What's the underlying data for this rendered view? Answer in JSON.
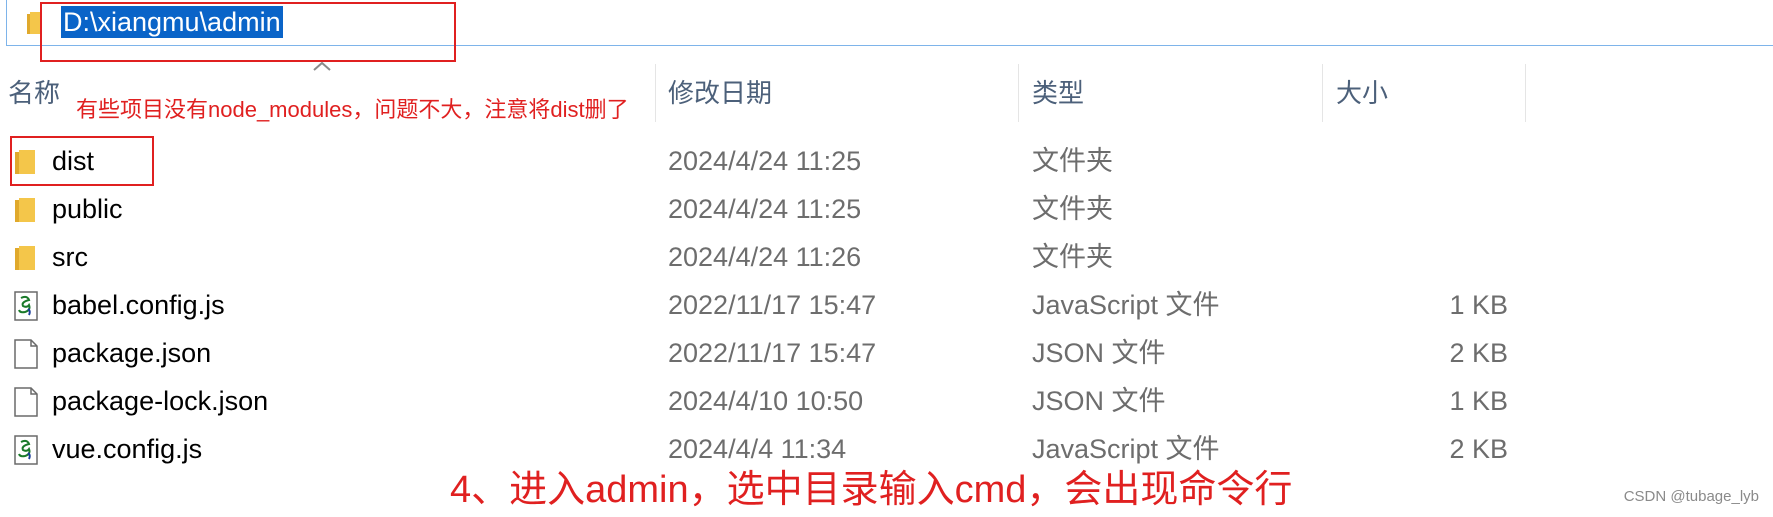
{
  "address_bar": {
    "path": "D:\\xiangmu\\admin"
  },
  "columns": {
    "name": "名称",
    "date": "修改日期",
    "type": "类型",
    "size": "大小"
  },
  "annotations": {
    "top": "有些项目没有node_modules，问题不大，注意将dist删了",
    "bottom": "4、进入admin，选中目录输入cmd，会出现命令行"
  },
  "files": [
    {
      "name": "dist",
      "date": "2024/4/24 11:25",
      "type": "文件夹",
      "size": "",
      "icon": "folder-icon"
    },
    {
      "name": "public",
      "date": "2024/4/24 11:25",
      "type": "文件夹",
      "size": "",
      "icon": "folder-icon"
    },
    {
      "name": "src",
      "date": "2024/4/24 11:26",
      "type": "文件夹",
      "size": "",
      "icon": "folder-icon"
    },
    {
      "name": "babel.config.js",
      "date": "2022/11/17 15:47",
      "type": "JavaScript 文件",
      "size": "1 KB",
      "icon": "script-file-icon"
    },
    {
      "name": "package.json",
      "date": "2022/11/17 15:47",
      "type": "JSON 文件",
      "size": "2 KB",
      "icon": "blank-file-icon"
    },
    {
      "name": "package-lock.json",
      "date": "2024/4/10 10:50",
      "type": "JSON 文件",
      "size": "1 KB",
      "icon": "blank-file-icon"
    },
    {
      "name": "vue.config.js",
      "date": "2024/4/4 11:34",
      "type": "JavaScript 文件",
      "size": "2 KB",
      "icon": "script-file-icon"
    }
  ],
  "watermark": "CSDN @tubage_lyb",
  "colors": {
    "annotation_red": "#e02020",
    "selection_blue": "#0a64c8",
    "folder_yellow": "#f4c64a"
  }
}
